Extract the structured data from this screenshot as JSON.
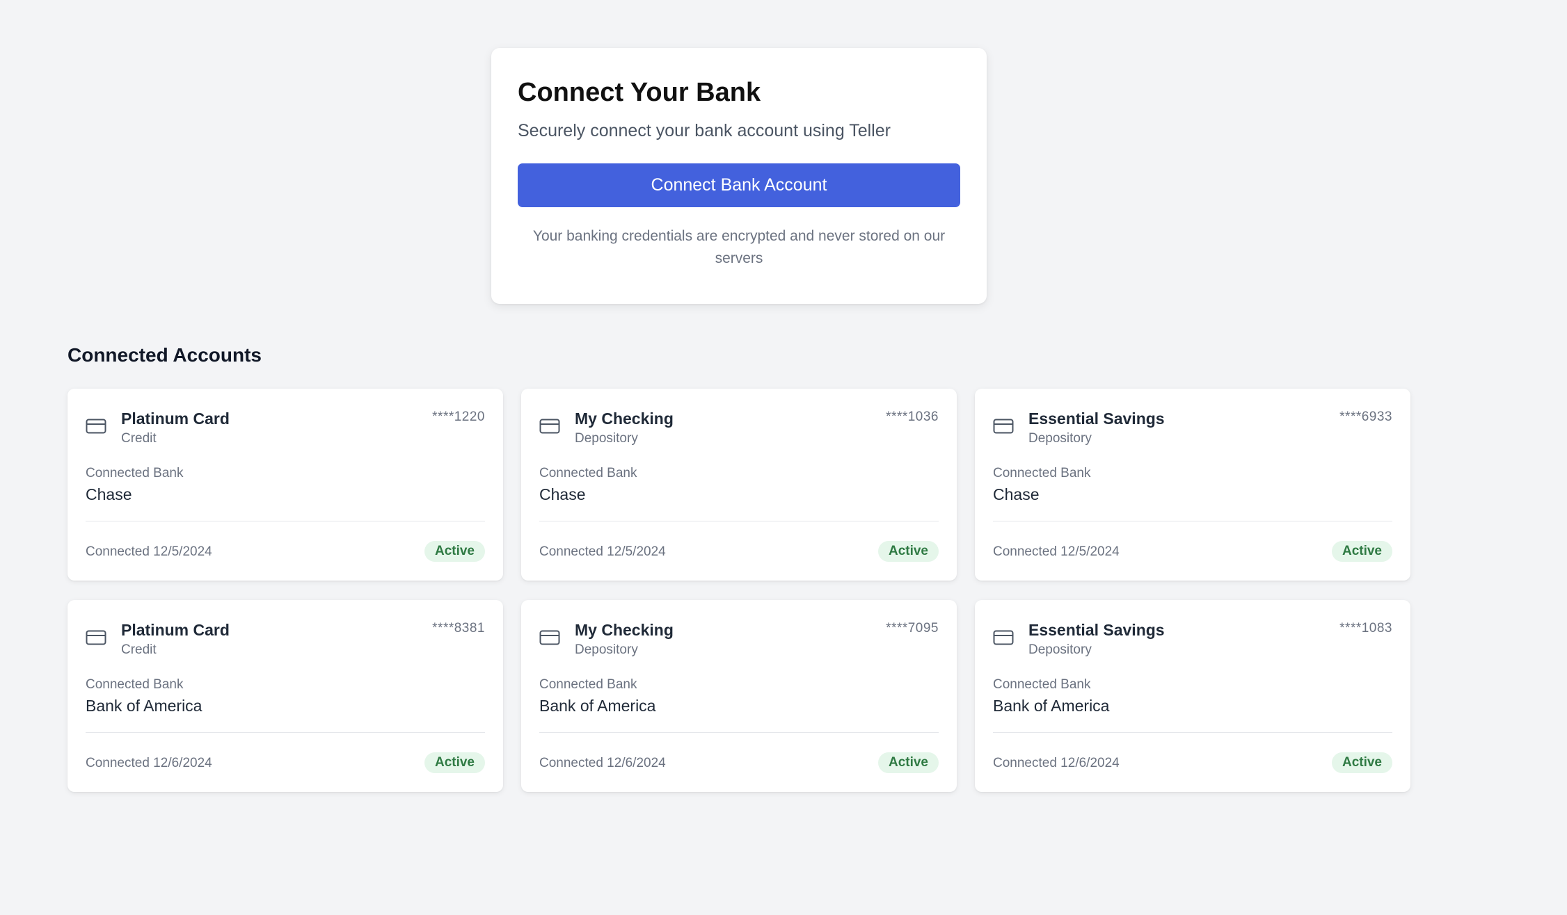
{
  "connect_panel": {
    "title": "Connect Your Bank",
    "subtitle": "Securely connect your bank account using Teller",
    "button_label": "Connect Bank Account",
    "note": "Your banking credentials are encrypted and never stored on our servers",
    "button_color": "#4361dd"
  },
  "accounts_section": {
    "title": "Connected Accounts",
    "bank_label": "Connected Bank",
    "icon": "credit-card-icon",
    "badge_color": "#e5f6ea",
    "badge_text_color": "#2f7a43",
    "accounts": [
      {
        "name": "Platinum Card",
        "type": "Credit",
        "mask": "****1220",
        "bank": "Chase",
        "connected": "Connected 12/5/2024",
        "status": "Active"
      },
      {
        "name": "My Checking",
        "type": "Depository",
        "mask": "****1036",
        "bank": "Chase",
        "connected": "Connected 12/5/2024",
        "status": "Active"
      },
      {
        "name": "Essential Savings",
        "type": "Depository",
        "mask": "****6933",
        "bank": "Chase",
        "connected": "Connected 12/5/2024",
        "status": "Active"
      },
      {
        "name": "Platinum Card",
        "type": "Credit",
        "mask": "****8381",
        "bank": "Bank of America",
        "connected": "Connected 12/6/2024",
        "status": "Active"
      },
      {
        "name": "My Checking",
        "type": "Depository",
        "mask": "****7095",
        "bank": "Bank of America",
        "connected": "Connected 12/6/2024",
        "status": "Active"
      },
      {
        "name": "Essential Savings",
        "type": "Depository",
        "mask": "****1083",
        "bank": "Bank of America",
        "connected": "Connected 12/6/2024",
        "status": "Active"
      }
    ]
  }
}
